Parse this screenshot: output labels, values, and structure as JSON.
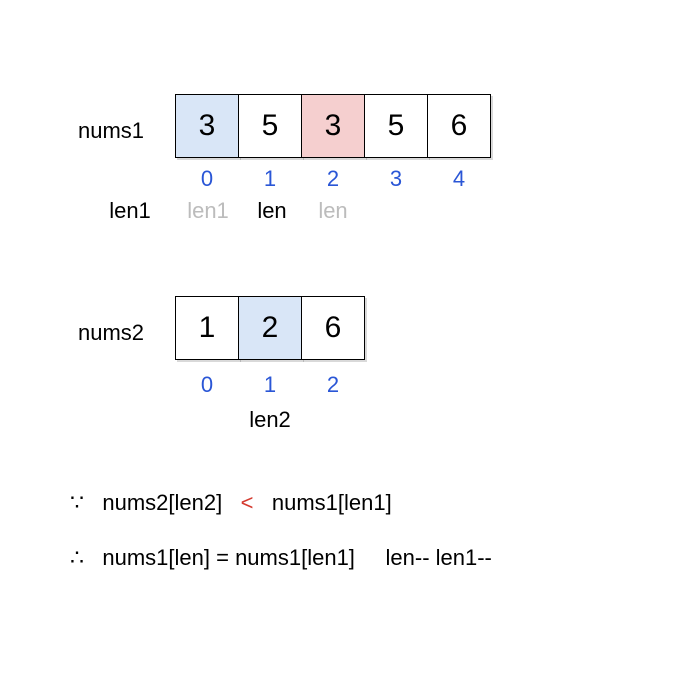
{
  "array1": {
    "label": "nums1",
    "cells": [
      {
        "value": "3",
        "highlight": "blue"
      },
      {
        "value": "5",
        "highlight": "none"
      },
      {
        "value": "3",
        "highlight": "red"
      },
      {
        "value": "5",
        "highlight": "none"
      },
      {
        "value": "6",
        "highlight": "none"
      }
    ],
    "indices": [
      "0",
      "1",
      "2",
      "3",
      "4"
    ],
    "pointers": [
      {
        "text": "len1",
        "color": "black"
      },
      {
        "text": "len1",
        "color": "grey"
      },
      {
        "text": "len",
        "color": "black"
      },
      {
        "text": "len",
        "color": "grey"
      },
      {
        "text": "",
        "color": "grey"
      }
    ]
  },
  "array2": {
    "label": "nums2",
    "cells": [
      {
        "value": "1",
        "highlight": "none"
      },
      {
        "value": "2",
        "highlight": "blue"
      },
      {
        "value": "6",
        "highlight": "none"
      }
    ],
    "indices": [
      "0",
      "1",
      "2"
    ],
    "pointer_label": "len2"
  },
  "statements": {
    "because_sym": "∵",
    "therefore_sym": "∴",
    "line1_left": "nums2[len2]",
    "line1_op": "<",
    "line1_right": "nums1[len1]",
    "line2_main": "nums1[len] = nums1[len1]",
    "line2_tail": "len-- len1--"
  }
}
